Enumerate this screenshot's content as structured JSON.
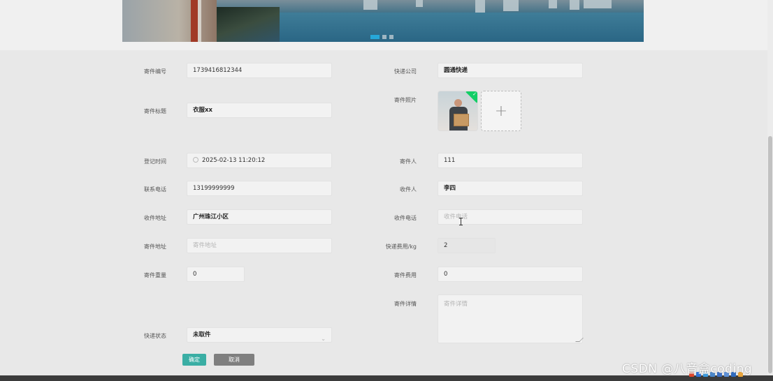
{
  "form": {
    "left": [
      {
        "key": "code",
        "label": "寄件编号",
        "value": "1739416812344",
        "placeholder": ""
      },
      {
        "key": "title",
        "label": "寄件标题",
        "value": "衣服xx",
        "placeholder": ""
      },
      {
        "key": "reg_time",
        "label": "登记时间",
        "value": "2025-02-13 11:20:12",
        "placeholder": ""
      },
      {
        "key": "phone",
        "label": "联系电话",
        "value": "13199999999",
        "placeholder": ""
      },
      {
        "key": "recv_addr",
        "label": "收件地址",
        "value": "广州珠江小区",
        "placeholder": ""
      },
      {
        "key": "send_addr",
        "label": "寄件地址",
        "value": "",
        "placeholder": "寄件地址"
      },
      {
        "key": "weight",
        "label": "寄件重量",
        "value": "0",
        "placeholder": ""
      },
      {
        "key": "status",
        "label": "快递状态",
        "value": "未取件",
        "placeholder": ""
      }
    ],
    "right": [
      {
        "key": "company",
        "label": "快递公司",
        "value": "圆通快递",
        "placeholder": ""
      },
      {
        "key": "photo",
        "label": "寄件照片",
        "value": "",
        "placeholder": ""
      },
      {
        "key": "sender",
        "label": "寄件人",
        "value": "111",
        "placeholder": ""
      },
      {
        "key": "receiver",
        "label": "收件人",
        "value": "李四",
        "placeholder": ""
      },
      {
        "key": "recv_phone",
        "label": "收件电话",
        "value": "",
        "placeholder": "收件电话"
      },
      {
        "key": "fee_per_kg",
        "label": "快递费用/kg",
        "value": "2",
        "placeholder": ""
      },
      {
        "key": "fee",
        "label": "寄件费用",
        "value": "0",
        "placeholder": ""
      },
      {
        "key": "detail",
        "label": "寄件详情",
        "value": "",
        "placeholder": "寄件详情"
      }
    ]
  },
  "buttons": {
    "confirm": "确定",
    "cancel": "取消"
  },
  "watermark": "CSDN @八音盒coding",
  "colors": {
    "confirm": "#3aaea4",
    "cancel": "#7f7f7f",
    "carousel_active": "#26a7d9",
    "upload_success": "#13ce66"
  },
  "icons": {
    "upload": "plus-icon",
    "date": "clock-icon",
    "select": "chevron-down-icon"
  }
}
